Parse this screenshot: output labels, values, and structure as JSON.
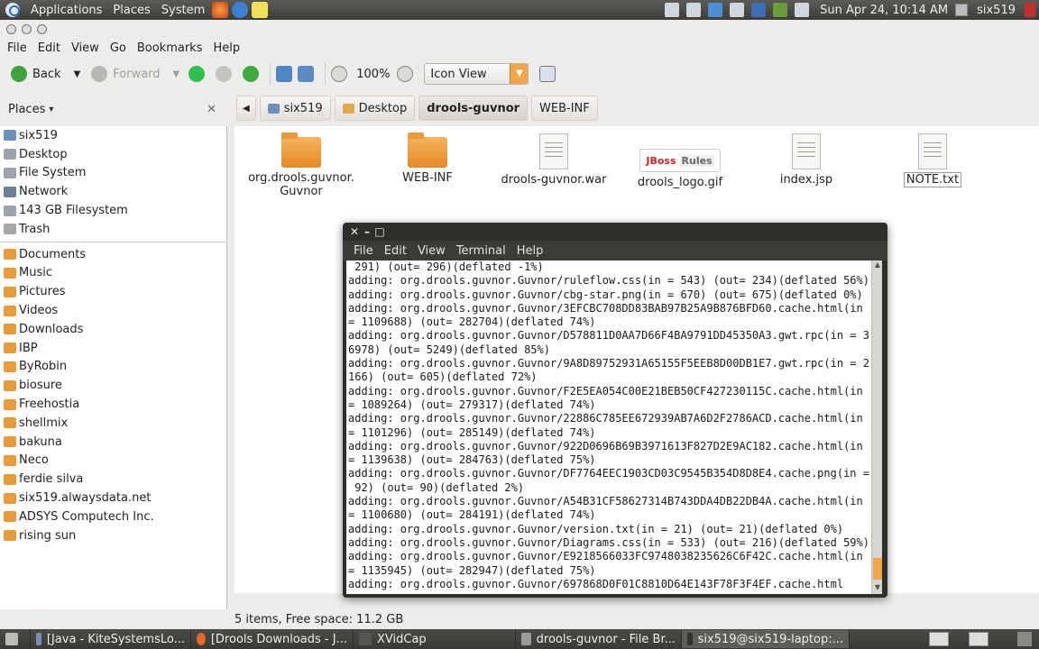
{
  "top_panel": {
    "menus": [
      "Applications",
      "Places",
      "System"
    ],
    "clock": "Sun Apr 24, 10:14 AM",
    "user": "six519"
  },
  "window": {
    "menubar": [
      "File",
      "Edit",
      "View",
      "Go",
      "Bookmarks",
      "Help"
    ],
    "toolbar": {
      "back": "Back",
      "forward": "Forward",
      "zoom": "100%",
      "view_mode": "Icon View"
    },
    "sidebar": {
      "header": "Places",
      "devices": [
        {
          "label": "six519",
          "icon": "home-icon"
        },
        {
          "label": "Desktop",
          "icon": "desktop-icon"
        },
        {
          "label": "File System",
          "icon": "drive-icon"
        },
        {
          "label": "Network",
          "icon": "network-icon"
        },
        {
          "label": "143 GB Filesystem",
          "icon": "drive-icon"
        },
        {
          "label": "Trash",
          "icon": "trash-icon"
        }
      ],
      "bookmarks": [
        "Documents",
        "Music",
        "Pictures",
        "Videos",
        "Downloads",
        "IBP",
        "ByRobin",
        "biosure",
        "Freehostia",
        "shellmix",
        "bakuna",
        "Neco",
        "ferdie silva",
        "six519.alwaysdata.net",
        "ADSYS Computech Inc.",
        "rising sun"
      ]
    },
    "pathbar": [
      "six519",
      "Desktop",
      "drools-guvnor",
      "WEB-INF"
    ],
    "files": [
      {
        "name": "org.drools.guvnor.",
        "name2": "Guvnor",
        "type": "folder"
      },
      {
        "name": "WEB-INF",
        "name2": "",
        "type": "folder"
      },
      {
        "name": "drools-guvnor.war",
        "name2": "",
        "type": "doc"
      },
      {
        "name": "drools_logo.gif",
        "name2": "",
        "type": "image"
      },
      {
        "name": "index.jsp",
        "name2": "",
        "type": "doc"
      },
      {
        "name": "NOTE.txt",
        "name2": "",
        "type": "doc"
      }
    ],
    "logo_text": {
      "a": "JBoss",
      "b": "Rules"
    },
    "status": "5 items, Free space: 11.2 GB"
  },
  "terminal": {
    "menu": [
      "File",
      "Edit",
      "View",
      "Terminal",
      "Help"
    ],
    "lines": [
      " 291) (out= 296)(deflated -1%)",
      "adding: org.drools.guvnor.Guvnor/ruleflow.css(in = 543) (out= 234)(deflated 56%)",
      "adding: org.drools.guvnor.Guvnor/cbg-star.png(in = 670) (out= 675)(deflated 0%)",
      "adding: org.drools.guvnor.Guvnor/3EFCBC708DD83BAB97B25A9B876BFD60.cache.html(in",
      "= 1109688) (out= 282704)(deflated 74%)",
      "adding: org.drools.guvnor.Guvnor/D578811D0AA7D66F4BA9791DD45350A3.gwt.rpc(in = 3",
      "6978) (out= 5249)(deflated 85%)",
      "adding: org.drools.guvnor.Guvnor/9A8D89752931A65155F5EEB8D00DB1E7.gwt.rpc(in = 2",
      "166) (out= 605)(deflated 72%)",
      "adding: org.drools.guvnor.Guvnor/F2E5EA054C00E21BEB50CF427230115C.cache.html(in",
      "= 1089264) (out= 279317)(deflated 74%)",
      "adding: org.drools.guvnor.Guvnor/22886C785EE672939AB7A6D2F2786ACD.cache.html(in",
      "= 1101296) (out= 285149)(deflated 74%)",
      "adding: org.drools.guvnor.Guvnor/922D0696B69B3971613F827D2E9AC182.cache.html(in",
      "= 1139638) (out= 284763)(deflated 75%)",
      "adding: org.drools.guvnor.Guvnor/DF7764EEC1903CD03C9545B354D8D8E4.cache.png(in =",
      " 92) (out= 90)(deflated 2%)",
      "adding: org.drools.guvnor.Guvnor/A54B31CF58627314B743DDA4DB22DB4A.cache.html(in",
      "= 1100680) (out= 284191)(deflated 74%)",
      "adding: org.drools.guvnor.Guvnor/version.txt(in = 21) (out= 21)(deflated 0%)",
      "adding: org.drools.guvnor.Guvnor/Diagrams.css(in = 533) (out= 216)(deflated 59%)",
      "adding: org.drools.guvnor.Guvnor/E9218566033FC9748038235626C6F42C.cache.html(in",
      "= 1135945) (out= 282947)(deflated 75%)",
      "adding: org.drools.guvnor.Guvnor/697868D0F01C8810D64E143F78F3F4EF.cache.html"
    ]
  },
  "taskbar": [
    "[Java - KiteSystemsLo...",
    "[Drools Downloads - J...",
    "XVidCap",
    "drools-guvnor - File Br...",
    "six519@six519-laptop:..."
  ],
  "colors": {
    "accent": "#f2a54a",
    "folder": "#e99a3b",
    "panel": "#3c3b37"
  }
}
